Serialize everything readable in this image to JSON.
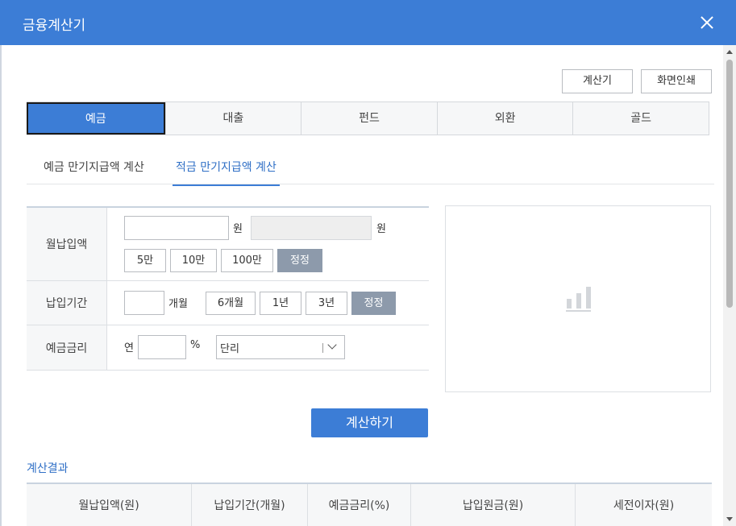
{
  "dialog": {
    "title": "금융계산기"
  },
  "toolbar": {
    "calculator_label": "계산기",
    "print_label": "화면인쇄"
  },
  "tabs": [
    {
      "label": "예금",
      "active": true
    },
    {
      "label": "대출",
      "active": false
    },
    {
      "label": "펀드",
      "active": false
    },
    {
      "label": "외환",
      "active": false
    },
    {
      "label": "골드",
      "active": false
    }
  ],
  "subtabs": [
    {
      "label": "예금 만기지급액 계산",
      "active": false
    },
    {
      "label": "적금 만기지급액 계산",
      "active": true
    }
  ],
  "form": {
    "monthly": {
      "label": "월납입액",
      "value": "",
      "unit": "원",
      "converted_value": "",
      "converted_unit": "원",
      "quick": [
        "5만",
        "10만",
        "100만"
      ],
      "reset": "정정"
    },
    "period": {
      "label": "납입기간",
      "value": "",
      "unit": "개월",
      "quick": [
        "6개월",
        "1년",
        "3년"
      ],
      "reset": "정정"
    },
    "rate": {
      "label": "예금금리",
      "prefix": "연",
      "value": "",
      "unit": "%",
      "interest_type": "단리"
    }
  },
  "chart_placeholder": {
    "icon": "bar-chart-icon"
  },
  "calculate_label": "계산하기",
  "result": {
    "title": "계산결과",
    "columns": [
      "월납입액(원)",
      "납입기간(개월)",
      "예금금리(%)",
      "납입원금(원)",
      "세전이자(원)"
    ]
  },
  "colors": {
    "accent": "#3c7dd6",
    "reset_button": "#8d9aab",
    "subtab_active": "#2f6fc6"
  }
}
